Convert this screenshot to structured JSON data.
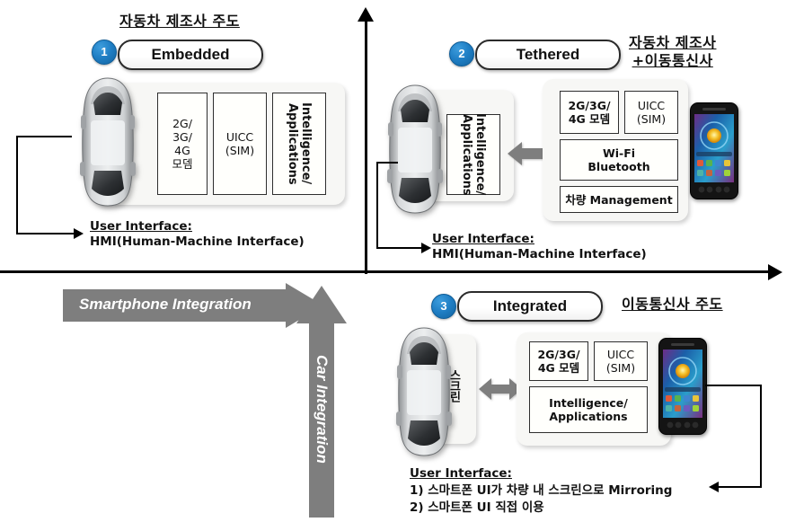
{
  "axes": {
    "vertical_arrow": "up-arrow",
    "horizontal_arrow": "right-arrow",
    "x_axis_label": "Smartphone Integration",
    "y_axis_label": "Car Integration"
  },
  "quadrants": [
    {
      "id": "embedded",
      "number": "1",
      "title": "Embedded",
      "header": "자동차 제조사 주도",
      "header_lines": [
        "자동차 제조사 주도"
      ],
      "modules": [
        {
          "label": "2G/\n3G/\n4G\n모뎀",
          "lines": [
            "2G/",
            "3G/",
            "4G",
            "모뎀"
          ],
          "orientation": "horizontal"
        },
        {
          "label": "UICC\n(SIM)",
          "lines": [
            "UICC",
            "(SIM)"
          ],
          "orientation": "horizontal"
        },
        {
          "label": "Intelligence/Applications",
          "lines": [
            "Intelligence/",
            "Applications"
          ],
          "orientation": "vertical"
        }
      ],
      "caption_head": "User Interface:",
      "caption_lines": [
        "HMI(Human-Machine Interface)"
      ],
      "has_phone": false
    },
    {
      "id": "tethered",
      "number": "2",
      "title": "Tethered",
      "header": "자동차 제조사 +이동통신사",
      "header_lines": [
        "자동차 제조사",
        "+이동통신사"
      ],
      "car_module": {
        "lines": [
          "Intelligence/",
          "Applications"
        ],
        "orientation": "vertical"
      },
      "modules": [
        {
          "lines": [
            "2G/3G/",
            "4G 모뎀"
          ],
          "orientation": "horizontal"
        },
        {
          "lines": [
            "UICC",
            "(SIM)"
          ],
          "orientation": "horizontal"
        },
        {
          "lines": [
            "Wi-Fi",
            "Bluetooth"
          ],
          "orientation": "horizontal"
        },
        {
          "lines": [
            "차량 Management"
          ],
          "orientation": "horizontal"
        }
      ],
      "caption_head": "User Interface:",
      "caption_lines": [
        "HMI(Human-Machine Interface)"
      ],
      "has_phone": true
    },
    {
      "id": "integrated",
      "number": "3",
      "title": "Integrated",
      "header": "이동통신사 주도",
      "header_lines": [
        "이동통신사 주도"
      ],
      "car_module": {
        "lines": [
          "스크린"
        ],
        "orientation": "vertical"
      },
      "modules": [
        {
          "lines": [
            "2G/3G/",
            "4G 모뎀"
          ],
          "orientation": "horizontal"
        },
        {
          "lines": [
            "UICC",
            "(SIM)"
          ],
          "orientation": "horizontal"
        },
        {
          "lines": [
            "Intelligence/",
            "Applications"
          ],
          "orientation": "horizontal"
        }
      ],
      "caption_head": "User Interface:",
      "caption_lines": [
        "1) 스마트폰 UI가 차량 내 스크린으로 Mirroring",
        "2) 스마트폰 UI 직접 이용"
      ],
      "has_phone": true
    }
  ],
  "colors": {
    "badge_blue": "#1f7ec4",
    "grey_arrow": "#7e7e7e",
    "panel_bg": "#f7f7f5",
    "box_border": "#2e2e2e",
    "axis": "#000000",
    "car_body": "#c9cbcd",
    "phone_body": "#121212"
  },
  "icons": {
    "car": "car-top-view-icon",
    "phone": "smartphone-icon",
    "double_arrow": "double-headed-arrow-icon"
  }
}
